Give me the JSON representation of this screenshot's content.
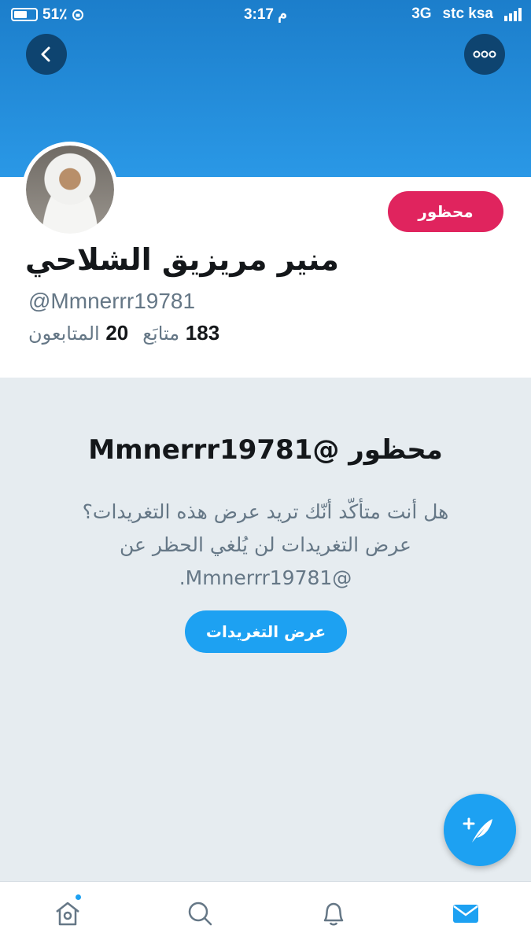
{
  "status_bar": {
    "battery": "51٪",
    "time": "3:17 م",
    "network": "3G",
    "carrier": "stc ksa"
  },
  "profile": {
    "name": "منير مريزيق الشلاحي",
    "handle": "@Mmnerrr19781",
    "following_count": "183",
    "following_label": "متابَع",
    "followers_count": "20",
    "followers_label": "المتابعون",
    "blocked_label": "محظور"
  },
  "blocked_notice": {
    "title": "محظور @Mmnerrr19781",
    "body": "هل أنت متأكّد أنّك تريد عرض هذه التغريدات؟ عرض التغريدات لن يُلغي الحظر عن @Mmnerrr19781.",
    "button": "عرض التغريدات"
  },
  "colors": {
    "header": "#2a98e6",
    "accent": "#1da1f2",
    "blocked": "#e0245e",
    "nav_dark": "#0e4470"
  },
  "tabs": [
    "home-icon",
    "search-icon",
    "notifications-icon",
    "messages-icon"
  ]
}
